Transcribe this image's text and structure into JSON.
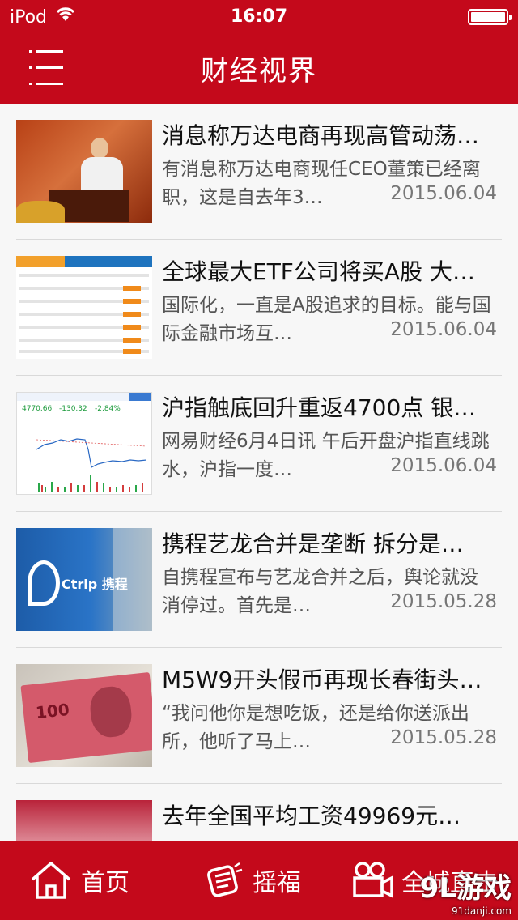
{
  "status_bar": {
    "carrier": "iPod",
    "time": "16:07"
  },
  "header": {
    "title": "财经视界"
  },
  "articles": [
    {
      "title": "消息称万达电商再现高管动荡…",
      "summary": "有消息称万达电商现任CEO董策已经离职，这是自去年3…",
      "date": "2015.06.04"
    },
    {
      "title": "全球最大ETF公司将买A股 大…",
      "summary": "国际化，一直是A股追求的目标。能与国际金融市场互…",
      "date": "2015.06.04"
    },
    {
      "title": "沪指触底回升重返4700点 银…",
      "summary": "网易财经6月4日讯 午后开盘沪指直线跳水，沪指一度…",
      "date": "2015.06.04"
    },
    {
      "title": "携程艺龙合并是垄断 拆分是…",
      "summary": "自携程宣布与艺龙合并之后，舆论就没消停过。首先是…",
      "date": "2015.05.28"
    },
    {
      "title": "M5W9开头假币再现长春街头…",
      "summary": "“我问他你是想吃饭，还是给你送派出所，他听了马上…",
      "date": "2015.05.28"
    },
    {
      "title": "去年全国平均工资49969元…",
      "summary": "",
      "date": ""
    }
  ],
  "thumbnails": {
    "chart_header_value": "4770.66",
    "chart_header_change": "-130.32",
    "chart_header_pct": "-2.84%",
    "ctrip_brand": "Ctrip 携程",
    "money_number": "100"
  },
  "tabbar": {
    "home": "首页",
    "lucky": "摇福",
    "city": "全城直击"
  },
  "watermark": {
    "brand": "9L游戏",
    "site": "91danji.com"
  },
  "colors": {
    "brand_red": "#c4091b"
  }
}
